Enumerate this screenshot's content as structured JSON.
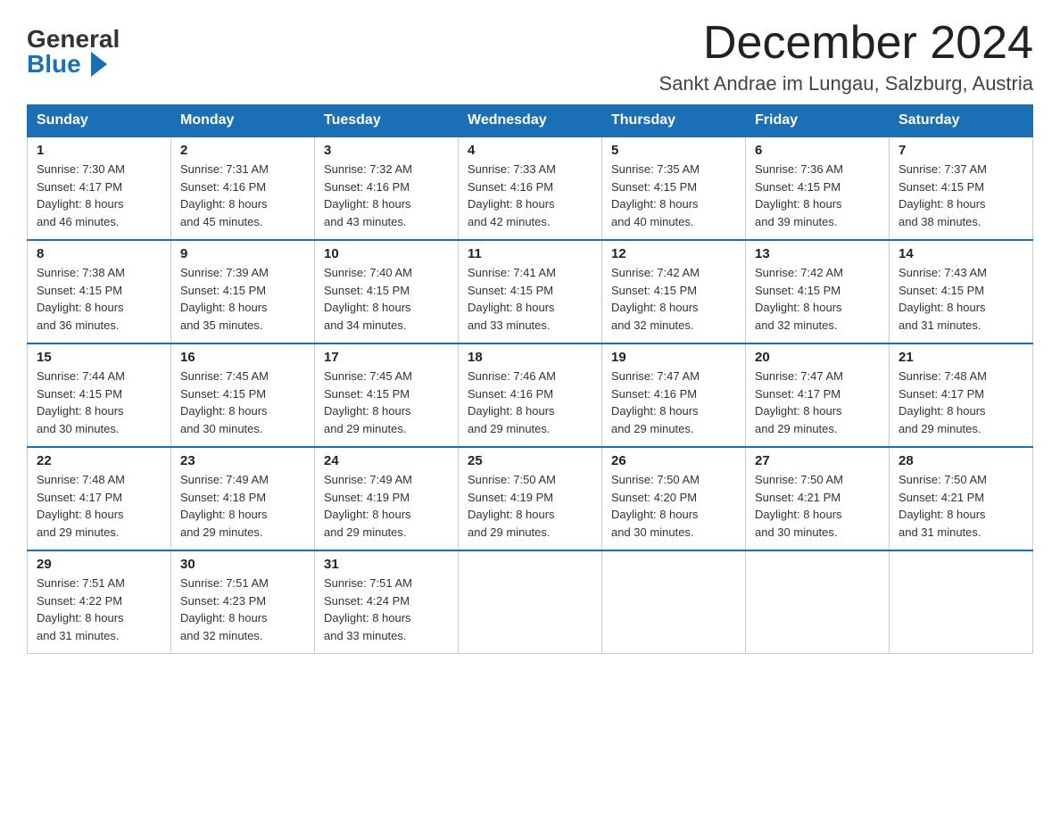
{
  "header": {
    "logo_general": "General",
    "logo_blue": "Blue",
    "month_title": "December 2024",
    "location": "Sankt Andrae im Lungau, Salzburg, Austria"
  },
  "weekdays": [
    "Sunday",
    "Monday",
    "Tuesday",
    "Wednesday",
    "Thursday",
    "Friday",
    "Saturday"
  ],
  "weeks": [
    [
      {
        "day": "1",
        "sunrise": "7:30 AM",
        "sunset": "4:17 PM",
        "daylight": "8 hours and 46 minutes."
      },
      {
        "day": "2",
        "sunrise": "7:31 AM",
        "sunset": "4:16 PM",
        "daylight": "8 hours and 45 minutes."
      },
      {
        "day": "3",
        "sunrise": "7:32 AM",
        "sunset": "4:16 PM",
        "daylight": "8 hours and 43 minutes."
      },
      {
        "day": "4",
        "sunrise": "7:33 AM",
        "sunset": "4:16 PM",
        "daylight": "8 hours and 42 minutes."
      },
      {
        "day": "5",
        "sunrise": "7:35 AM",
        "sunset": "4:15 PM",
        "daylight": "8 hours and 40 minutes."
      },
      {
        "day": "6",
        "sunrise": "7:36 AM",
        "sunset": "4:15 PM",
        "daylight": "8 hours and 39 minutes."
      },
      {
        "day": "7",
        "sunrise": "7:37 AM",
        "sunset": "4:15 PM",
        "daylight": "8 hours and 38 minutes."
      }
    ],
    [
      {
        "day": "8",
        "sunrise": "7:38 AM",
        "sunset": "4:15 PM",
        "daylight": "8 hours and 36 minutes."
      },
      {
        "day": "9",
        "sunrise": "7:39 AM",
        "sunset": "4:15 PM",
        "daylight": "8 hours and 35 minutes."
      },
      {
        "day": "10",
        "sunrise": "7:40 AM",
        "sunset": "4:15 PM",
        "daylight": "8 hours and 34 minutes."
      },
      {
        "day": "11",
        "sunrise": "7:41 AM",
        "sunset": "4:15 PM",
        "daylight": "8 hours and 33 minutes."
      },
      {
        "day": "12",
        "sunrise": "7:42 AM",
        "sunset": "4:15 PM",
        "daylight": "8 hours and 32 minutes."
      },
      {
        "day": "13",
        "sunrise": "7:42 AM",
        "sunset": "4:15 PM",
        "daylight": "8 hours and 32 minutes."
      },
      {
        "day": "14",
        "sunrise": "7:43 AM",
        "sunset": "4:15 PM",
        "daylight": "8 hours and 31 minutes."
      }
    ],
    [
      {
        "day": "15",
        "sunrise": "7:44 AM",
        "sunset": "4:15 PM",
        "daylight": "8 hours and 30 minutes."
      },
      {
        "day": "16",
        "sunrise": "7:45 AM",
        "sunset": "4:15 PM",
        "daylight": "8 hours and 30 minutes."
      },
      {
        "day": "17",
        "sunrise": "7:45 AM",
        "sunset": "4:15 PM",
        "daylight": "8 hours and 29 minutes."
      },
      {
        "day": "18",
        "sunrise": "7:46 AM",
        "sunset": "4:16 PM",
        "daylight": "8 hours and 29 minutes."
      },
      {
        "day": "19",
        "sunrise": "7:47 AM",
        "sunset": "4:16 PM",
        "daylight": "8 hours and 29 minutes."
      },
      {
        "day": "20",
        "sunrise": "7:47 AM",
        "sunset": "4:17 PM",
        "daylight": "8 hours and 29 minutes."
      },
      {
        "day": "21",
        "sunrise": "7:48 AM",
        "sunset": "4:17 PM",
        "daylight": "8 hours and 29 minutes."
      }
    ],
    [
      {
        "day": "22",
        "sunrise": "7:48 AM",
        "sunset": "4:17 PM",
        "daylight": "8 hours and 29 minutes."
      },
      {
        "day": "23",
        "sunrise": "7:49 AM",
        "sunset": "4:18 PM",
        "daylight": "8 hours and 29 minutes."
      },
      {
        "day": "24",
        "sunrise": "7:49 AM",
        "sunset": "4:19 PM",
        "daylight": "8 hours and 29 minutes."
      },
      {
        "day": "25",
        "sunrise": "7:50 AM",
        "sunset": "4:19 PM",
        "daylight": "8 hours and 29 minutes."
      },
      {
        "day": "26",
        "sunrise": "7:50 AM",
        "sunset": "4:20 PM",
        "daylight": "8 hours and 30 minutes."
      },
      {
        "day": "27",
        "sunrise": "7:50 AM",
        "sunset": "4:21 PM",
        "daylight": "8 hours and 30 minutes."
      },
      {
        "day": "28",
        "sunrise": "7:50 AM",
        "sunset": "4:21 PM",
        "daylight": "8 hours and 31 minutes."
      }
    ],
    [
      {
        "day": "29",
        "sunrise": "7:51 AM",
        "sunset": "4:22 PM",
        "daylight": "8 hours and 31 minutes."
      },
      {
        "day": "30",
        "sunrise": "7:51 AM",
        "sunset": "4:23 PM",
        "daylight": "8 hours and 32 minutes."
      },
      {
        "day": "31",
        "sunrise": "7:51 AM",
        "sunset": "4:24 PM",
        "daylight": "8 hours and 33 minutes."
      },
      null,
      null,
      null,
      null
    ]
  ],
  "labels": {
    "sunrise": "Sunrise:",
    "sunset": "Sunset:",
    "daylight": "Daylight:"
  }
}
